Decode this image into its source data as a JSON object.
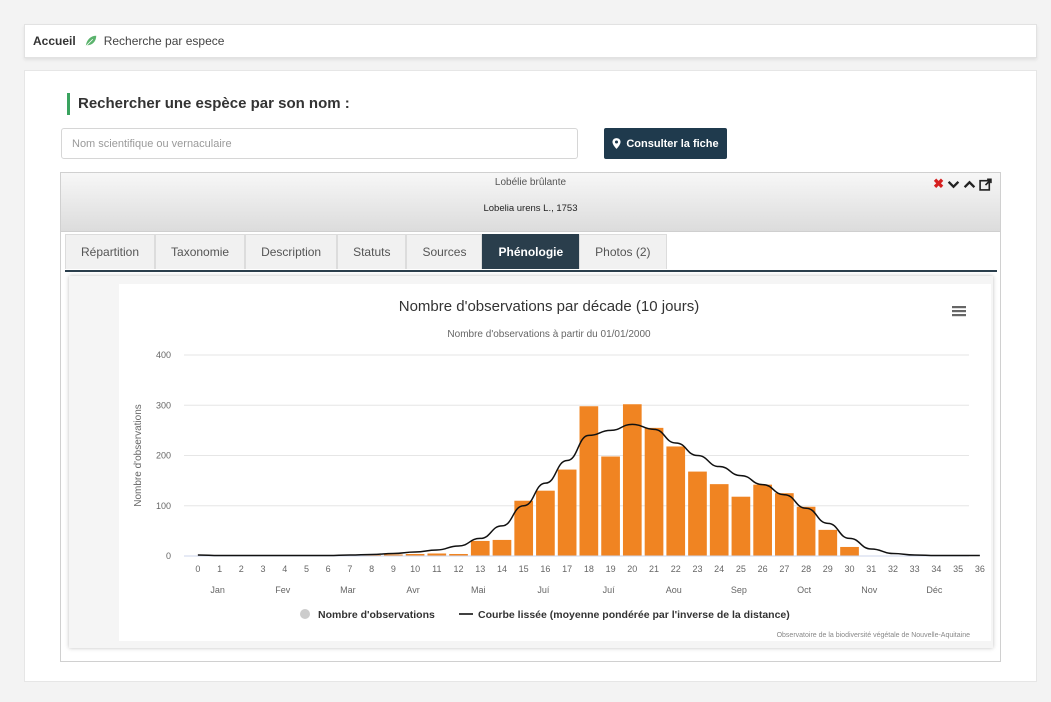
{
  "breadcrumb": {
    "home": "Accueil",
    "current": "Recherche par espece"
  },
  "search": {
    "heading": "Rechercher une espèce par son nom :",
    "placeholder": "Nom scientifique ou vernaculaire",
    "button_label": "Consulter la fiche",
    "button_icon": "location-pin-icon"
  },
  "species": {
    "common_name": "Lobélie brûlante",
    "scientific_name": "Lobelia urens L., 1753",
    "actions": [
      "close-icon",
      "chevron-down-icon",
      "chevron-up-icon",
      "external-link-icon"
    ]
  },
  "tabs": [
    {
      "label": "Répartition",
      "active": false
    },
    {
      "label": "Taxonomie",
      "active": false
    },
    {
      "label": "Description",
      "active": false
    },
    {
      "label": "Statuts",
      "active": false
    },
    {
      "label": "Sources",
      "active": false
    },
    {
      "label": "Phénologie",
      "active": true
    },
    {
      "label": "Photos (2)",
      "active": false
    }
  ],
  "colors": {
    "bar": "#f08422",
    "curve": "#111111",
    "dark_blue": "#1f3a4d",
    "accent_green": "#3aa35f"
  },
  "chart_data": {
    "type": "bar",
    "title": "Nombre d'observations par décade (10 jours)",
    "subtitle": "Nombre d'observations à partir du 01/01/2000",
    "ylabel": "Nombre d'observations",
    "xlabel": "",
    "ylim": [
      0,
      400
    ],
    "yticks": [
      0,
      100,
      200,
      300,
      400
    ],
    "grid": true,
    "categories": [
      "0",
      "1",
      "2",
      "3",
      "4",
      "5",
      "6",
      "7",
      "8",
      "9",
      "10",
      "11",
      "12",
      "13",
      "14",
      "15",
      "16",
      "17",
      "18",
      "19",
      "20",
      "21",
      "22",
      "23",
      "24",
      "25",
      "26",
      "27",
      "28",
      "29",
      "30",
      "31",
      "32",
      "33",
      "34",
      "35",
      "36"
    ],
    "months": [
      "Jan",
      "Fev",
      "Mar",
      "Avr",
      "Mai",
      "Juí",
      "Juí",
      "Aou",
      "Sep",
      "Oct",
      "Nov",
      "Déc"
    ],
    "series": [
      {
        "name": "Nombre d'observations",
        "type": "bar",
        "values": [
          0,
          0,
          0,
          0,
          0,
          0,
          0,
          0,
          2,
          3,
          4,
          5,
          4,
          30,
          32,
          110,
          130,
          172,
          298,
          198,
          302,
          255,
          218,
          168,
          143,
          118,
          142,
          125,
          98,
          52,
          18,
          0,
          0,
          0,
          0,
          0,
          0
        ]
      },
      {
        "name": "Courbe lissée (moyenne pondérée par l'inverse de la distance)",
        "type": "line",
        "values": [
          2,
          1,
          1,
          1,
          1,
          1,
          1,
          2,
          3,
          5,
          8,
          12,
          20,
          35,
          60,
          100,
          145,
          190,
          240,
          250,
          262,
          252,
          225,
          200,
          178,
          160,
          142,
          122,
          95,
          65,
          35,
          14,
          5,
          2,
          1,
          1,
          1
        ]
      }
    ],
    "legend_position": "bottom",
    "menu_icon": "hamburger-menu-icon",
    "credits": "Observatoire de la biodiversité végétale de Nouvelle-Aquitaine"
  }
}
